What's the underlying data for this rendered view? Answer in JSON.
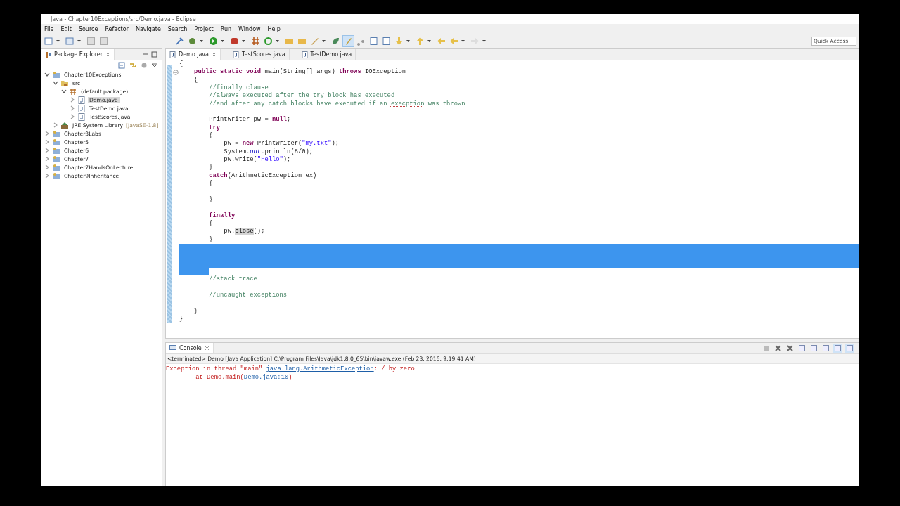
{
  "window": {
    "title": "Java - Chapter10Exceptions/src/Demo.java - Eclipse"
  },
  "menu": [
    "File",
    "Edit",
    "Source",
    "Refactor",
    "Navigate",
    "Search",
    "Project",
    "Run",
    "Window",
    "Help"
  ],
  "quick_access": {
    "placeholder": "Quick Access"
  },
  "explorer": {
    "title": "Package Explorer",
    "tree": [
      {
        "label": "Chapter10Exceptions",
        "kind": "project",
        "expanded": true,
        "selected": false,
        "children": [
          {
            "label": "src",
            "kind": "folder",
            "expanded": true,
            "selected": false,
            "children": [
              {
                "label": "(default package)",
                "kind": "package",
                "expanded": true,
                "selected": false,
                "children": [
                  {
                    "label": "Demo.java",
                    "kind": "file",
                    "expanded": false,
                    "selected": true
                  },
                  {
                    "label": "TestDemo.java",
                    "kind": "file",
                    "expanded": false,
                    "selected": false
                  },
                  {
                    "label": "TestScores.java",
                    "kind": "file",
                    "expanded": false,
                    "selected": false
                  }
                ]
              }
            ]
          },
          {
            "label": "JRE System Library",
            "decoration": "[JavaSE-1.8]",
            "kind": "library",
            "expanded": false,
            "selected": false
          }
        ]
      },
      {
        "label": "Chapter3Labs",
        "kind": "project",
        "expanded": false,
        "selected": false
      },
      {
        "label": "Chapter5",
        "kind": "project",
        "expanded": false,
        "selected": false
      },
      {
        "label": "Chapter6",
        "kind": "project",
        "expanded": false,
        "selected": false
      },
      {
        "label": "Chapter7",
        "kind": "project",
        "expanded": false,
        "selected": false
      },
      {
        "label": "Chapter7HandsOnLecture",
        "kind": "project",
        "expanded": false,
        "selected": false
      },
      {
        "label": "Chapter9Inheritance",
        "kind": "project",
        "expanded": false,
        "selected": false
      }
    ]
  },
  "editor": {
    "tabs": [
      {
        "label": "Demo.java",
        "selected": true
      },
      {
        "label": "TestScores.java",
        "selected": false
      },
      {
        "label": "TestDemo.java",
        "selected": false
      }
    ],
    "lines": [
      {
        "kind": "code",
        "segments": [
          {
            "kind": "plain",
            "text": "{"
          }
        ]
      },
      {
        "kind": "folding",
        "segments": [
          {
            "kind": "kw",
            "text": "    public static void"
          },
          {
            "kind": "plain",
            "text": " main(String[] args) "
          },
          {
            "kind": "kw",
            "text": "throws"
          },
          {
            "kind": "plain",
            "text": " IOException"
          }
        ]
      },
      {
        "kind": "code",
        "segments": [
          {
            "kind": "plain",
            "text": "    {"
          }
        ]
      },
      {
        "kind": "code",
        "segments": [
          {
            "kind": "comment",
            "text": "        //finally clause"
          }
        ]
      },
      {
        "kind": "code",
        "segments": [
          {
            "kind": "comment",
            "text": "        //always executed after the try block has executed"
          }
        ]
      },
      {
        "kind": "code",
        "segments": [
          {
            "kind": "comment",
            "text": "        //and after any catch blocks have executed if an "
          },
          {
            "kind": "misspelled",
            "text": "execption"
          },
          {
            "kind": "comment",
            "text": " was thrown"
          }
        ]
      },
      {
        "kind": "code"
      },
      {
        "kind": "code",
        "segments": [
          {
            "kind": "plain",
            "text": "        PrintWriter pw = "
          },
          {
            "kind": "kw",
            "text": "null"
          },
          {
            "kind": "plain",
            "text": ";"
          }
        ]
      },
      {
        "kind": "code",
        "segments": [
          {
            "kind": "kw",
            "text": "        try"
          }
        ]
      },
      {
        "kind": "code",
        "segments": [
          {
            "kind": "plain",
            "text": "        {"
          }
        ]
      },
      {
        "kind": "code",
        "segments": [
          {
            "kind": "plain",
            "text": "            pw = "
          },
          {
            "kind": "kw",
            "text": "new"
          },
          {
            "kind": "plain",
            "text": " PrintWriter("
          },
          {
            "kind": "string",
            "text": "\"my.txt\""
          },
          {
            "kind": "plain",
            "text": ");"
          }
        ]
      },
      {
        "kind": "code",
        "segments": [
          {
            "kind": "plain",
            "text": "            System."
          },
          {
            "kind": "field",
            "text": "out"
          },
          {
            "kind": "plain",
            "text": ".println(8/0);"
          }
        ]
      },
      {
        "kind": "code",
        "segments": [
          {
            "kind": "plain",
            "text": "            pw.write("
          },
          {
            "kind": "string",
            "text": "\"Hello\""
          },
          {
            "kind": "plain",
            "text": ");"
          }
        ]
      },
      {
        "kind": "code",
        "segments": [
          {
            "kind": "plain",
            "text": "        }"
          }
        ]
      },
      {
        "kind": "code",
        "segments": [
          {
            "kind": "kw",
            "text": "        catch"
          },
          {
            "kind": "plain",
            "text": "(ArithmeticException ex)"
          }
        ]
      },
      {
        "kind": "code",
        "segments": [
          {
            "kind": "plain",
            "text": "        {"
          }
        ]
      },
      {
        "kind": "code"
      },
      {
        "kind": "code",
        "segments": [
          {
            "kind": "plain",
            "text": "        }"
          }
        ]
      },
      {
        "kind": "code"
      },
      {
        "kind": "code",
        "segments": [
          {
            "kind": "kw",
            "text": "        finally"
          }
        ]
      },
      {
        "kind": "code",
        "segments": [
          {
            "kind": "plain",
            "text": "        {"
          }
        ]
      },
      {
        "kind": "code",
        "segments": [
          {
            "kind": "plain",
            "text": "            pw."
          },
          {
            "kind": "occurrence",
            "text": "close"
          },
          {
            "kind": "plain",
            "text": "();"
          }
        ]
      },
      {
        "kind": "code",
        "segments": [
          {
            "kind": "plain",
            "text": "        }"
          }
        ]
      },
      {
        "kind": "selected"
      },
      {
        "kind": "selected"
      },
      {
        "kind": "selected"
      },
      {
        "kind": "selected_partial"
      },
      {
        "kind": "code",
        "segments": [
          {
            "kind": "comment",
            "text": "        //stack trace"
          }
        ]
      },
      {
        "kind": "code"
      },
      {
        "kind": "code",
        "segments": [
          {
            "kind": "comment",
            "text": "        //uncaught exceptions"
          }
        ]
      },
      {
        "kind": "code"
      },
      {
        "kind": "code",
        "segments": [
          {
            "kind": "plain",
            "text": "    }"
          }
        ]
      },
      {
        "kind": "code",
        "segments": [
          {
            "kind": "plain",
            "text": "}"
          }
        ]
      }
    ]
  },
  "console": {
    "title": "Console",
    "status": "<terminated> Demo [Java Application] C:\\Program Files\\Java\\jdk1.8.0_65\\bin\\javaw.exe (Feb 23, 2016, 9:19:41 AM)",
    "output": [
      [
        {
          "kind": "error",
          "text": "Exception in thread \"main\" "
        },
        {
          "kind": "link",
          "text": "java.lang.ArithmeticException"
        },
        {
          "kind": "error",
          "text": ": / by zero"
        }
      ],
      [
        {
          "kind": "error",
          "text": "        at Demo.main("
        },
        {
          "kind": "link",
          "text": "Demo.java:10"
        },
        {
          "kind": "error",
          "text": ")"
        }
      ]
    ]
  }
}
